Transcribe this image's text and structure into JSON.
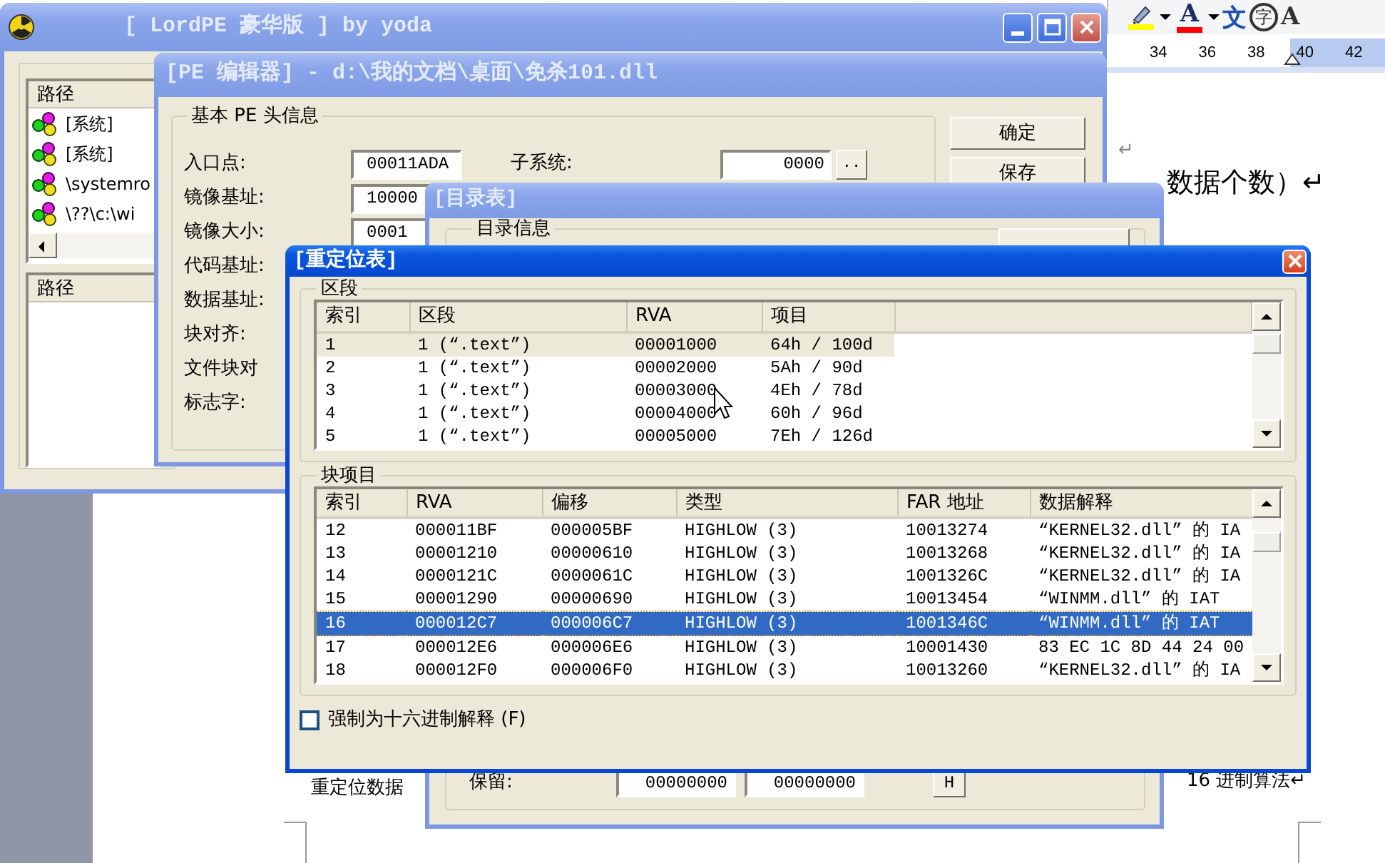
{
  "word_toolbar": [
    {
      "kind": "highlighter",
      "color": "#ffff00"
    },
    {
      "kind": "caret"
    },
    {
      "kind": "font-color",
      "glyph": "A",
      "color": "#ff0000"
    },
    {
      "kind": "caret"
    },
    {
      "kind": "phonetic",
      "glyph": "文"
    },
    {
      "kind": "enclosed",
      "glyph": "字"
    },
    {
      "kind": "plain",
      "glyph": "A"
    }
  ],
  "ruler": {
    "numbers": [
      "34",
      "36",
      "38",
      "40",
      "42"
    ]
  },
  "document": {
    "mark_line": "↵",
    "line_right": "数据个数）↵",
    "line_bottom_left": "重定位数据",
    "line_bottom_right": "16 进制算法↵"
  },
  "main_window": {
    "title": "[ LordPE 豪华版 ] by yoda",
    "active": false,
    "title_buttons": [
      {
        "kind": "minimize"
      },
      {
        "kind": "maximize"
      },
      {
        "kind": "close"
      }
    ],
    "process_list": {
      "header": "路径",
      "items": [
        {
          "name": "[系统]"
        },
        {
          "name": "[系统]"
        },
        {
          "name": "\\systemro"
        },
        {
          "name": "\\??\\c:\\wi"
        }
      ]
    },
    "module_list": {
      "header": "路径"
    }
  },
  "pe_editor": {
    "title": "[PE 编辑器] - d:\\我的文档\\桌面\\免杀101.dll",
    "active": false,
    "group": "基本 PE 头信息",
    "fields": [
      {
        "label": "入口点:",
        "value": "00011ADA"
      },
      {
        "label": "镜像基址:",
        "value": "10000"
      },
      {
        "label": "镜像大小:",
        "value": "0001"
      },
      {
        "label": "代码基址:"
      },
      {
        "label": "数据基址:"
      },
      {
        "label": "块对齐:"
      },
      {
        "label": "文件块对"
      },
      {
        "label": "标志字:"
      }
    ],
    "subsystem": {
      "label": "子系统:",
      "value": "0000",
      "button": ".."
    },
    "buttons": [
      "确定",
      "保存"
    ]
  },
  "directory_window": {
    "title": "[目录表]",
    "active": false,
    "group": "目录信息",
    "reserved": {
      "label": "保留:",
      "values": [
        "00000000",
        "00000000"
      ],
      "button": "H"
    }
  },
  "relocation_window": {
    "title": "[重定位表]",
    "active": true,
    "title_buttons": [
      {
        "kind": "close"
      }
    ],
    "sections": {
      "group": "区段",
      "focused": false,
      "columns": [
        "索引",
        "区段",
        "RVA",
        "项目"
      ],
      "rows": [
        {
          "cells": [
            "1",
            "1 (“.text”)",
            "00001000",
            "64h / 100d"
          ],
          "selected": true
        },
        {
          "cells": [
            "2",
            "1 (“.text”)",
            "00002000",
            "5Ah / 90d"
          ],
          "selected": false
        },
        {
          "cells": [
            "3",
            "1 (“.text”)",
            "00003000",
            "4Eh / 78d"
          ],
          "selected": false
        },
        {
          "cells": [
            "4",
            "1 (“.text”)",
            "00004000",
            "60h / 96d"
          ],
          "selected": false
        },
        {
          "cells": [
            "5",
            "1 (“.text”)",
            "00005000",
            "7Eh / 126d"
          ],
          "selected": false
        }
      ]
    },
    "blocks": {
      "group": "块项目",
      "focused": true,
      "columns": [
        "索引",
        "RVA",
        "偏移",
        "类型",
        "FAR 地址",
        "数据解释"
      ],
      "rows": [
        {
          "cells": [
            "12",
            "000011BF",
            "000005BF",
            "HIGHLOW (3)",
            "10013274",
            "“KERNEL32.dll” 的 IA"
          ],
          "selected": false
        },
        {
          "cells": [
            "13",
            "00001210",
            "00000610",
            "HIGHLOW (3)",
            "10013268",
            "“KERNEL32.dll” 的 IA"
          ],
          "selected": false
        },
        {
          "cells": [
            "14",
            "0000121C",
            "0000061C",
            "HIGHLOW (3)",
            "1001326C",
            "“KERNEL32.dll” 的 IA"
          ],
          "selected": false
        },
        {
          "cells": [
            "15",
            "00001290",
            "00000690",
            "HIGHLOW (3)",
            "10013454",
            "“WINMM.dll” 的 IAT"
          ],
          "selected": false
        },
        {
          "cells": [
            "16",
            "000012C7",
            "000006C7",
            "HIGHLOW (3)",
            "1001346C",
            "“WINMM.dll” 的 IAT"
          ],
          "selected": true
        },
        {
          "cells": [
            "17",
            "000012E6",
            "000006E6",
            "HIGHLOW (3)",
            "10001430",
            "83 EC 1C 8D 44 24 00"
          ],
          "selected": false
        },
        {
          "cells": [
            "18",
            "000012F0",
            "000006F0",
            "HIGHLOW (3)",
            "10013260",
            "“KERNEL32.dll” 的 IA"
          ],
          "selected": false
        }
      ]
    },
    "force_hex": {
      "label": "强制为十六进制解释 (F)",
      "checked": false
    }
  }
}
